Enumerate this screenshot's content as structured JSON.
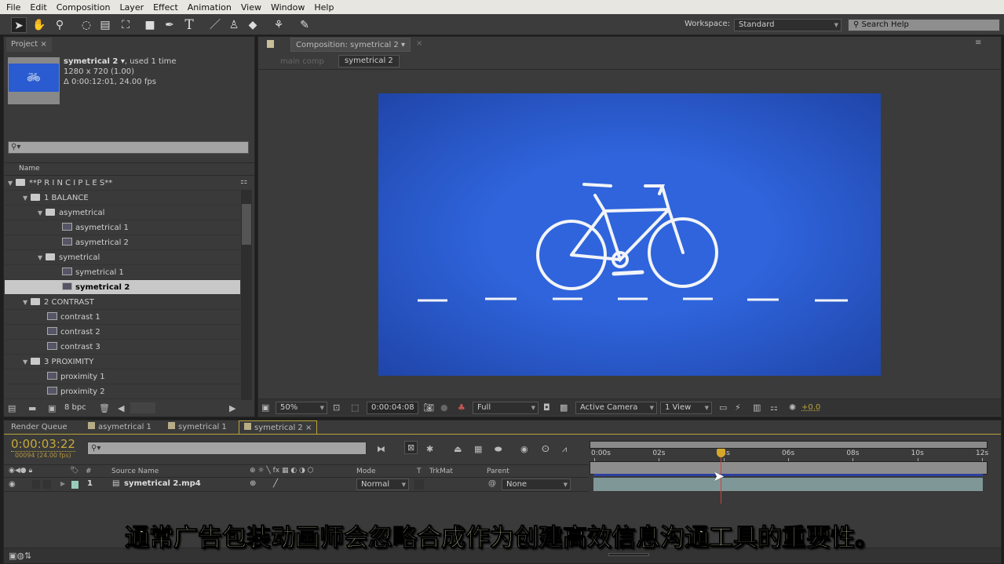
{
  "menu": [
    "File",
    "Edit",
    "Composition",
    "Layer",
    "Effect",
    "Animation",
    "View",
    "Window",
    "Help"
  ],
  "workspace": {
    "label": "Workspace:",
    "value": "Standard"
  },
  "search_help": {
    "placeholder": "Search Help"
  },
  "project": {
    "tab": "Project",
    "item_name": "symetrical 2 ▾",
    "used": ", used 1 time",
    "dimensions": "1280 x 720 (1.00)",
    "duration": "Δ 0:00:12:01, 24.00 fps",
    "column_name": "Name",
    "tree": [
      {
        "label": "**P R I N C I P L E S**",
        "level": 0,
        "type": "folder"
      },
      {
        "label": "1 BALANCE",
        "level": 1,
        "type": "folder"
      },
      {
        "label": "asymetrical",
        "level": 2,
        "type": "folder"
      },
      {
        "label": "asymetrical 1",
        "level": 3,
        "type": "comp"
      },
      {
        "label": "asymetrical 2",
        "level": 3,
        "type": "comp"
      },
      {
        "label": "symetrical",
        "level": 2,
        "type": "folder"
      },
      {
        "label": "symetrical 1",
        "level": 3,
        "type": "comp"
      },
      {
        "label": "symetrical 2",
        "level": 3,
        "type": "comp",
        "selected": true
      },
      {
        "label": "2 CONTRAST",
        "level": 1,
        "type": "folder"
      },
      {
        "label": "contrast 1",
        "level": 2,
        "type": "comp"
      },
      {
        "label": "contrast 2",
        "level": 2,
        "type": "comp"
      },
      {
        "label": "contrast 3",
        "level": 2,
        "type": "comp"
      },
      {
        "label": "3 PROXIMITY",
        "level": 1,
        "type": "folder"
      },
      {
        "label": "proximity 1",
        "level": 2,
        "type": "comp"
      },
      {
        "label": "proximity 2",
        "level": 2,
        "type": "comp"
      }
    ],
    "bpc": "8 bpc"
  },
  "composition": {
    "tab": "Composition: symetrical 2",
    "breadcrumbs": [
      "main comp",
      "symetrical 2"
    ],
    "zoom": "50%",
    "timecode": "0:00:04:08",
    "resolution": "Full",
    "camera": "Active Camera",
    "views": "1 View",
    "exposure": "+0.0",
    "canvas_color": "#2a5bd0"
  },
  "timeline": {
    "tabs": [
      "Render Queue",
      "asymetrical 1",
      "symetrical 1",
      "symetrical 2"
    ],
    "current_time": "0:00:03:22",
    "frame": "00094 (24.00 fps)",
    "columns": {
      "source": "Source Name",
      "mode": "Mode",
      "t": "T",
      "trkmat": "TrkMat",
      "parent": "Parent",
      "num": "#"
    },
    "layers": [
      {
        "num": "1",
        "name": "symetrical 2.mp4",
        "mode": "Normal",
        "parent": "None"
      }
    ],
    "ruler": [
      "0:00s",
      "02s",
      "04s",
      "06s",
      "08s",
      "10s",
      "12s"
    ],
    "playhead_seconds": 3.92
  },
  "subtitle": "通常广告包装动画师会忽略合成作为创建高效信息沟通工具的重要性。"
}
